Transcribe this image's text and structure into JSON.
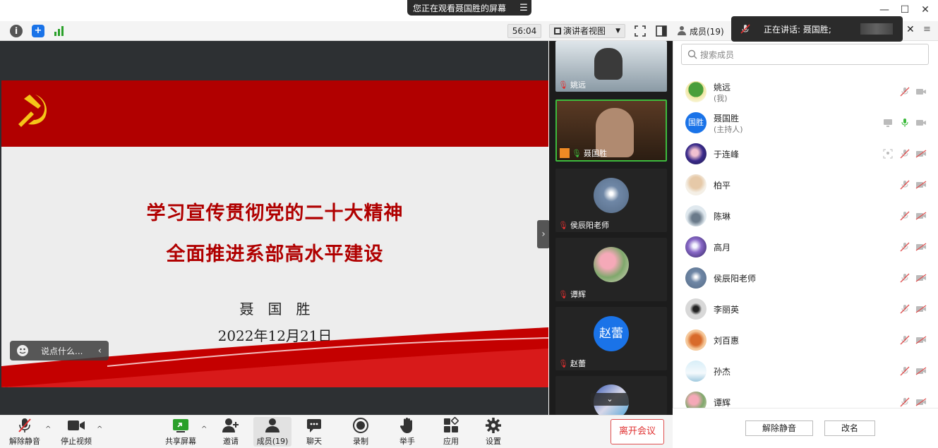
{
  "banner": {
    "text": "您正在观看聂国胜的屏幕"
  },
  "toolbar": {
    "timer": "56:04",
    "view_mode": "演讲者视图"
  },
  "slide": {
    "line1": "学习宣传贯彻党的二十大精神",
    "line2": "全面推进系部高水平建设",
    "author": "聂　国　胜",
    "date": "2022年12月21日"
  },
  "chat_placeholder": "说点什么...",
  "thumbnails": [
    {
      "name": "姚远"
    },
    {
      "name": "聂国胜"
    },
    {
      "name": "侯辰阳老师"
    },
    {
      "name": "谭辉"
    },
    {
      "name": "赵蕾",
      "avatar_text": "赵蕾"
    }
  ],
  "panel": {
    "title": "成员(19)",
    "speaking": "正在讲话: 聂国胜;",
    "search_placeholder": "搜索成员",
    "mute_all": "解除静音",
    "rename": "改名"
  },
  "members": [
    {
      "name": "姚远",
      "sub": "(我)"
    },
    {
      "name": "聂国胜",
      "sub": "(主持人)",
      "avatar_text": "国胜"
    },
    {
      "name": "于连峰"
    },
    {
      "name": "柏平"
    },
    {
      "name": "陈琳"
    },
    {
      "name": "高月"
    },
    {
      "name": "侯辰阳老师"
    },
    {
      "name": "李丽英"
    },
    {
      "name": "刘百惠"
    },
    {
      "name": "孙杰"
    },
    {
      "name": "谭辉"
    }
  ],
  "bottom": {
    "unmute": "解除静音",
    "stop_video": "停止视频",
    "share": "共享屏幕",
    "invite": "邀请",
    "members": "成员(19)",
    "chat": "聊天",
    "record": "录制",
    "raise_hand": "举手",
    "apps": "应用",
    "settings": "设置",
    "leave": "离开会议"
  },
  "colors": {
    "accent": "#1a73e8",
    "slide_red": "#b10000",
    "leave_red": "#e03030",
    "mic_green": "#3dbb3d"
  }
}
